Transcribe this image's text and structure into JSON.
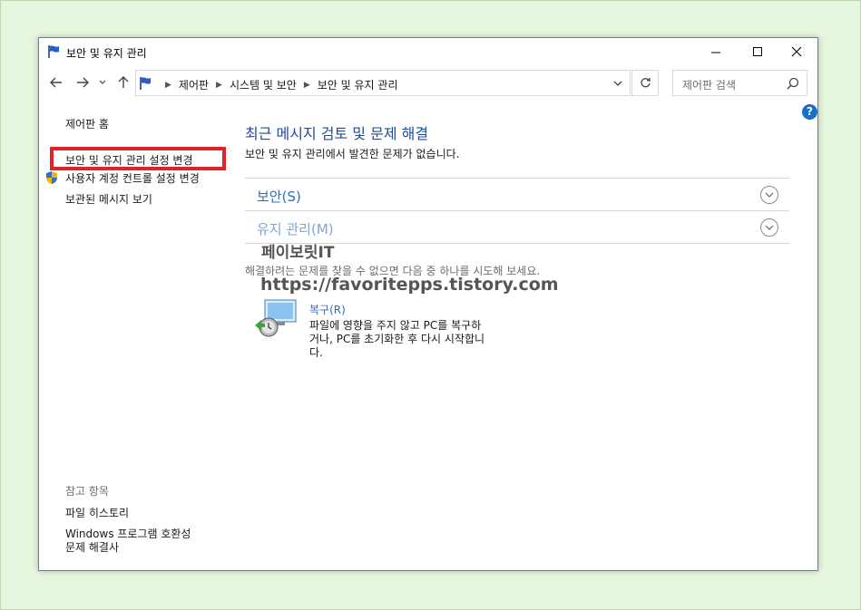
{
  "window": {
    "title": "보안 및 유지 관리"
  },
  "address": {
    "breadcrumbs": [
      "제어판",
      "시스템 및 보안",
      "보안 및 유지 관리"
    ],
    "search_placeholder": "제어판 검색"
  },
  "sidebar": {
    "home": "제어판 홈",
    "change_settings": "보안 및 유지 관리 설정 변경",
    "uac_settings": "사용자 계정 컨트롤 설정 변경",
    "archived_messages": "보관된 메시지 보기",
    "see_also": "참고 항목",
    "file_history": "파일 히스토리",
    "compat_line1": "Windows 프로그램 호환성",
    "compat_line2": "문제 해결사"
  },
  "main": {
    "heading": "최근 메시지 검토 및 문제 해결",
    "status": "보안 및 유지 관리에서 발견한 문제가 없습니다.",
    "sections": [
      "보안(S)",
      "유지 관리(M)"
    ],
    "hint": "해결하려는 문제를 찾을 수 없으면 다음 중 하나를 시도해 보세요.",
    "recovery": {
      "title": "복구(R)",
      "description": "파일에 영향을 주지 않고 PC를 복구하거나, PC를 초기화한 후 다시 시작합니다."
    }
  },
  "watermark": {
    "name": "페이보릿IT",
    "url": "https://favoritepps.tistory.com"
  },
  "colors": {
    "accent_blue": "#1e4b9e",
    "link_blue": "#2a6fc5",
    "highlight_red": "#e0222a",
    "background_green": "#e6f5dd"
  }
}
